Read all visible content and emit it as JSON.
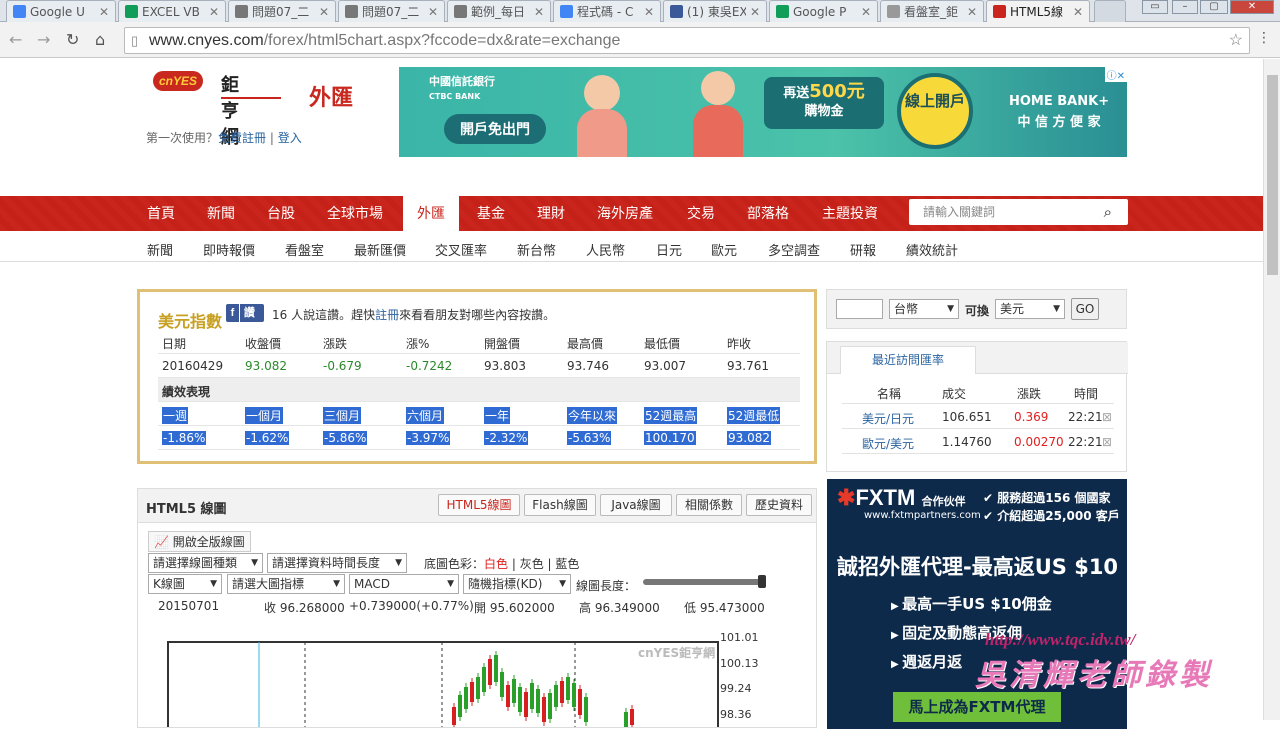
{
  "browser": {
    "tabs": [
      {
        "title": "Google U",
        "color": "#4285f4",
        "active": false
      },
      {
        "title": "EXCEL VB",
        "color": "#0f9d58",
        "active": false
      },
      {
        "title": "問題07_二",
        "color": "#777777",
        "active": false
      },
      {
        "title": "問題07_二",
        "color": "#777777",
        "active": false
      },
      {
        "title": "範例_每日",
        "color": "#777777",
        "active": false
      },
      {
        "title": "程式碼 - C",
        "color": "#4285f4",
        "active": false
      },
      {
        "title": "(1) 東吳EX",
        "color": "#3b5998",
        "active": false
      },
      {
        "title": "Google P",
        "color": "#0f9d58",
        "active": false
      },
      {
        "title": "看盤室_鉅",
        "color": "#999999",
        "active": false
      },
      {
        "title": "HTML5線",
        "color": "#c9251d",
        "active": true
      }
    ],
    "url_domain": "www.cnyes.com",
    "url_path": "/forex/html5chart.aspx?fccode=dx&rate=exchange"
  },
  "header": {
    "logo_text": "cnYES",
    "logo_cn": "鉅亨網",
    "section_title": "外匯",
    "first_use": "第一次使用？",
    "register": "免費註冊",
    "login": "登入"
  },
  "banner": {
    "bank": "中國信託銀行",
    "bank_en": "CTBC BANK",
    "open_free": "開戶免出門",
    "gift_top": "再送",
    "gift_amount": "500元",
    "gift_bottom": "購物金",
    "online_open": "線上開戶",
    "homebank": "HOME BANK+",
    "homebank_sub": "中 信 方 便 家"
  },
  "mainnav": {
    "items": [
      "首頁",
      "新聞",
      "台股",
      "全球市場",
      "外匯",
      "基金",
      "理財",
      "海外房產",
      "交易",
      "部落格",
      "主題投資"
    ],
    "active": "外匯",
    "search_placeholder": "請輸入關鍵詞"
  },
  "subnav": [
    "新聞",
    "即時報價",
    "看盤室",
    "最新匯價",
    "交叉匯率",
    "新台幣",
    "人民幣",
    "日元",
    "歐元",
    "多空調查",
    "研報",
    "績效統計"
  ],
  "index_panel": {
    "title": "美元指數",
    "fb_label": "讚",
    "fb_text_pre": "16 人說這讚。趕快",
    "fb_link": "註冊",
    "fb_text_post": "來看看朋友對哪些內容按讚。",
    "columns": [
      "日期",
      "收盤價",
      "漲跌",
      "漲%",
      "開盤價",
      "最高價",
      "最低價",
      "昨收"
    ],
    "values": [
      "20160429",
      "93.082",
      "-0.679",
      "-0.7242",
      "93.803",
      "93.746",
      "93.007",
      "93.761"
    ],
    "perf_label": "績效表現",
    "perf_columns": [
      "一週",
      "一個月",
      "三個月",
      "六個月",
      "一年",
      "今年以來",
      "52週最高",
      "52週最低"
    ],
    "perf_values": [
      "-1.86%",
      "-1.62%",
      "-5.86%",
      "-3.97%",
      "-2.32%",
      "-5.63%",
      "100.170",
      "93.082"
    ]
  },
  "converter": {
    "amount": "",
    "from": "台幣",
    "label": "可換",
    "to": "美元",
    "go": "GO"
  },
  "recent_rates": {
    "tab": "最近訪問匯率",
    "columns": [
      "名稱",
      "成交",
      "漲跌",
      "時間"
    ],
    "rows": [
      {
        "name": "美元/日元",
        "price": "106.651",
        "change": "0.369",
        "time": "22:21"
      },
      {
        "name": "歐元/美元",
        "price": "1.14760",
        "change": "0.00270",
        "time": "22:21"
      }
    ]
  },
  "chart_panel": {
    "title": "HTML5 線圖",
    "buttons": [
      "HTML5線圖",
      "Flash線圖",
      "Java線圖",
      "相關係數",
      "歷史資料"
    ],
    "fullscreen": "開啟全版線圖",
    "chart_type": "請選擇線圖種類",
    "period": "請選擇資料時間長度",
    "bg_label": "底圖色彩：",
    "bg_options": [
      "白色",
      "灰色",
      "藍色"
    ],
    "ktype": "K線圖",
    "main_indicator": "請選大圖指標",
    "ind1": "MACD",
    "ind2": "隨機指標(KD)",
    "length_label": "線圖長度：",
    "info_date": "20150701",
    "info_close": "收 96.268000",
    "info_change": "+0.739000(+0.77%)",
    "info_open": "開 95.602000",
    "info_high": "高 96.349000",
    "info_low": "低 95.473000",
    "watermark": "cnYES鉅亨網",
    "y_ticks": [
      "101.01",
      "100.13",
      "99.24",
      "98.36"
    ]
  },
  "ad_fxtm": {
    "brand": "FXTM",
    "partner": "合作伙伴",
    "site": "www.fxtmpartners.com",
    "bullet1": "服務超過156 個國家",
    "bullet2": "介紹超過25,000 客戶",
    "headline": "誠招外匯代理-最高返US $10",
    "items": [
      "最高一手US $10佣金",
      "固定及動態高返佣",
      "週返月返"
    ],
    "cta": "馬上成為FXTM代理"
  },
  "overlay": {
    "url": "http://www.tqc.idv.tw/",
    "text": "吳清輝老師錄製"
  },
  "colors": {
    "brand_red": "#c9251d",
    "gold": "#c8a021",
    "selection": "#2f6bd2",
    "down_red": "#e02020",
    "up_green": "#2a8a2a"
  }
}
